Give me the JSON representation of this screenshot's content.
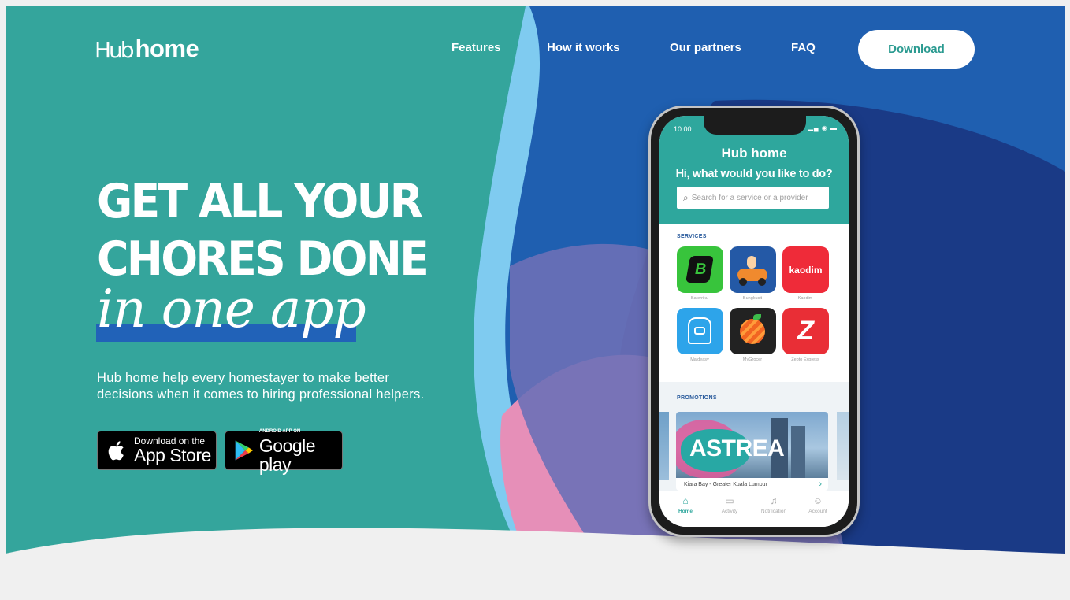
{
  "brand": {
    "logo_hub": "Hub",
    "logo_home": "home"
  },
  "nav": {
    "items": [
      {
        "label": "Features"
      },
      {
        "label": "How it works"
      },
      {
        "label": "Our partners"
      },
      {
        "label": "FAQ"
      }
    ],
    "download_label": "Download"
  },
  "hero": {
    "headline_line1": "GET ALL YOUR",
    "headline_line2": "CHORES DONE",
    "script_line": "in one app",
    "description": "Hub home help every homestayer to make better decisions when it comes to hiring professional helpers."
  },
  "stores": {
    "apple": {
      "small": "Download on the",
      "big": "App Store"
    },
    "google": {
      "small": "ANDROID APP ON",
      "big": "Google play"
    }
  },
  "phone": {
    "time": "10:00",
    "app_logo": "Hub home",
    "question": "Hi, what would you like to do?",
    "search_placeholder": "Search for a service or a provider",
    "services_label": "SERVICES",
    "services": [
      {
        "name": "Baterriku"
      },
      {
        "name": "Bungkusit"
      },
      {
        "name": "Kaodim",
        "logo_text": "kaodim"
      },
      {
        "name": "Maideasy"
      },
      {
        "name": "MyGrocer"
      },
      {
        "name": "Zepto Express"
      }
    ],
    "promotions_label": "PROMOTIONS",
    "promo": {
      "title": "ASTREA",
      "caption": "Kiara Bay - Greater Kuala Lumpur"
    },
    "tabs": [
      {
        "label": "Home"
      },
      {
        "label": "Activity"
      },
      {
        "label": "Notification"
      },
      {
        "label": "Account"
      }
    ]
  },
  "colors": {
    "teal": "#34a59c",
    "blue": "#1f5fb0",
    "navy": "#1a3a86",
    "pink": "#e68fb8",
    "light_blue": "#7fcbf0"
  }
}
